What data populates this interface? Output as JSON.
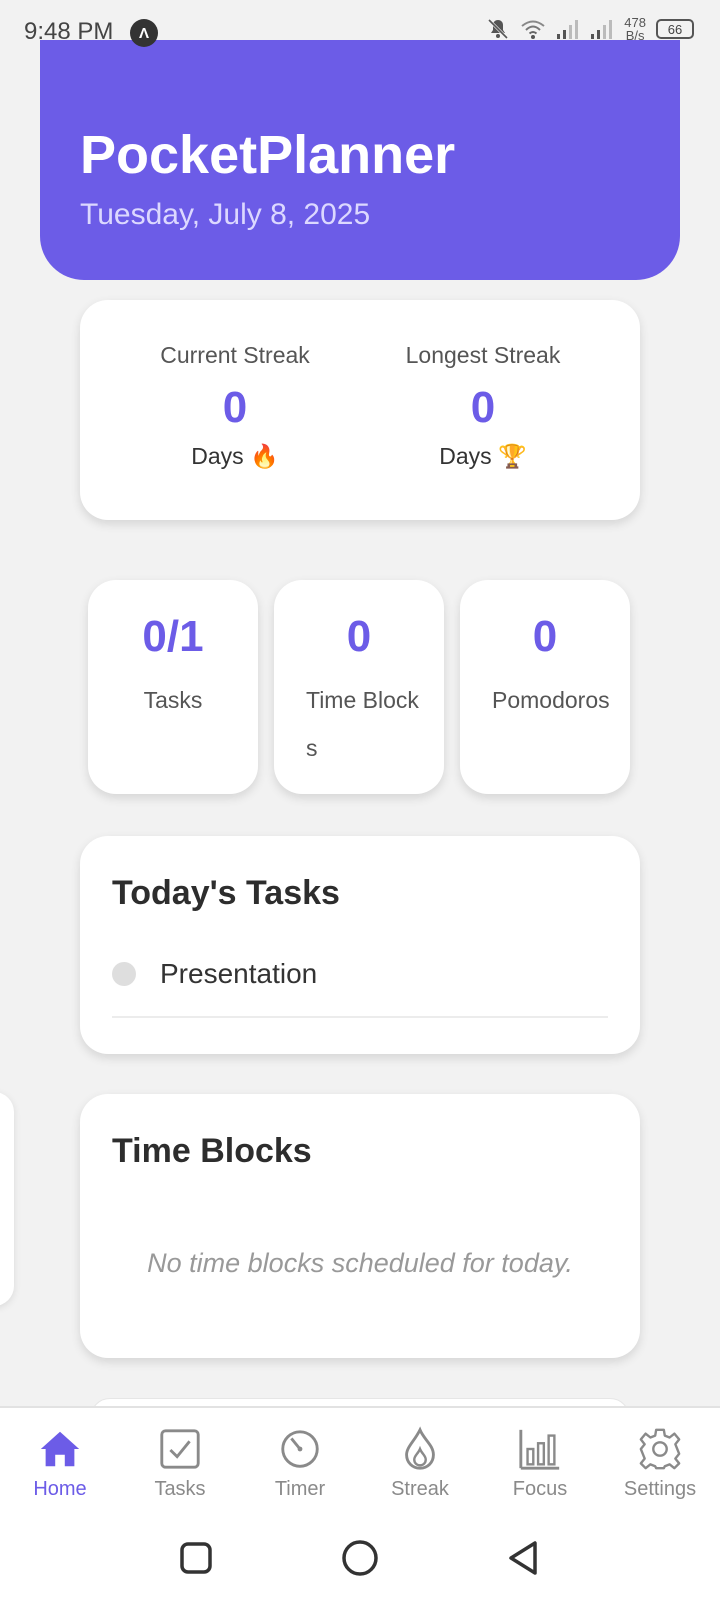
{
  "status_bar": {
    "time": "9:48 PM",
    "app_indicator": "Λ",
    "net_speed_value": "478",
    "net_speed_unit": "B/s",
    "battery": "66"
  },
  "header": {
    "title": "PocketPlanner",
    "date": "Tuesday, July 8, 2025",
    "color": "#6c5ce7"
  },
  "streaks": {
    "current": {
      "label": "Current Streak",
      "value": "0",
      "unit": "Days 🔥"
    },
    "longest": {
      "label": "Longest Streak",
      "value": "0",
      "unit": "Days 🏆"
    }
  },
  "stats": [
    {
      "value": "0/1",
      "label": "Tasks"
    },
    {
      "value": "0",
      "label": "Time Blocks"
    },
    {
      "value": "0",
      "label": "Pomodoros"
    }
  ],
  "tasks_section": {
    "title": "Today's Tasks",
    "tasks": [
      {
        "text": "Presentation"
      }
    ]
  },
  "time_blocks_section": {
    "title": "Time Blocks",
    "empty_message": "No time blocks scheduled for today."
  },
  "bottom_nav": {
    "items": [
      {
        "label": "Home",
        "icon": "home-icon",
        "active": true
      },
      {
        "label": "Tasks",
        "icon": "checkbox-icon"
      },
      {
        "label": "Timer",
        "icon": "timer-icon"
      },
      {
        "label": "Streak",
        "icon": "flame-icon"
      },
      {
        "label": "Focus",
        "icon": "bar-chart-icon"
      },
      {
        "label": "Settings",
        "icon": "gear-icon"
      }
    ]
  }
}
